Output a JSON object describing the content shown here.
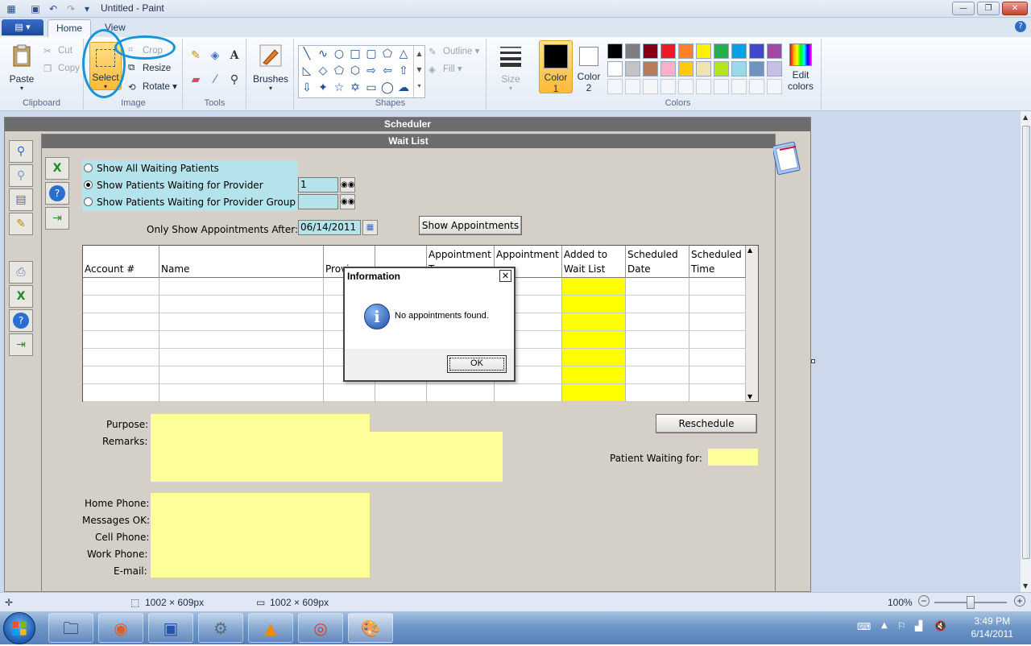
{
  "window": {
    "title": "Untitled - Paint"
  },
  "ribbon": {
    "file_tab": "▤ ▾",
    "tabs": [
      {
        "label": "Home",
        "active": true
      },
      {
        "label": "View",
        "active": false
      }
    ],
    "clipboard": {
      "paste": "Paste",
      "cut": "Cut",
      "copy": "Copy",
      "group": "Clipboard"
    },
    "image": {
      "select": "Select",
      "crop": "Crop",
      "resize": "Resize",
      "rotate": "Rotate",
      "group": "Image"
    },
    "tools": {
      "group": "Tools"
    },
    "brushes": "Brushes",
    "shapes": {
      "outline": "Outline",
      "fill": "Fill",
      "group": "Shapes"
    },
    "size": "Size",
    "colors": {
      "color1_label": "Color",
      "color1_num": "1",
      "color2_label": "Color",
      "color2_num": "2",
      "edit_label": "Edit",
      "edit_label2": "colors",
      "group": "Colors",
      "palette_row1": [
        "#000000",
        "#7f7f7f",
        "#880015",
        "#ed1c24",
        "#ff7f27",
        "#fff200",
        "#22b14c",
        "#00a2e8",
        "#3f48cc",
        "#a349a4"
      ],
      "palette_row2": [
        "#ffffff",
        "#c3c3c3",
        "#b97a57",
        "#ffaec9",
        "#ffc90e",
        "#efe4b0",
        "#b5e61d",
        "#99d9ea",
        "#7092be",
        "#c8bfe7"
      ],
      "accent": "#1a93d9"
    }
  },
  "scheduler": {
    "title": "Scheduler",
    "waitlist": {
      "title": "Wait List",
      "radios": [
        {
          "label": "Show All Waiting Patients",
          "selected": false
        },
        {
          "label": "Show Patients Waiting for Provider",
          "selected": true
        },
        {
          "label": "Show Patients Waiting for Provider Group",
          "selected": false
        }
      ],
      "provider_value": "1",
      "provider_group_value": "",
      "only_show_after_label": "Only Show Appointments After:",
      "date_value": "06/14/2011",
      "show_appointments_button": "Show Appointments",
      "columns": [
        {
          "l1": "",
          "l2": "Account #"
        },
        {
          "l1": "",
          "l2": "Name"
        },
        {
          "l1": "",
          "l2": "Provi"
        },
        {
          "l1": "",
          "l2": ""
        },
        {
          "l1": "Appointment",
          "l2": "T"
        },
        {
          "l1": "Appointment",
          "l2": ""
        },
        {
          "l1": "Added to",
          "l2": "Wait List"
        },
        {
          "l1": "Scheduled",
          "l2": "Date"
        },
        {
          "l1": "Scheduled",
          "l2": "Time"
        }
      ],
      "row_count": 7,
      "purpose_label": "Purpose:",
      "remarks_label": "Remarks:",
      "reschedule_button": "Reschedule",
      "patient_waiting_for_label": "Patient Waiting for:",
      "home_phone_label": "Home Phone:",
      "messages_ok_label": "Messages OK:",
      "cell_phone_label": "Cell Phone:",
      "work_phone_label": "Work Phone:",
      "email_label": "E-mail:"
    }
  },
  "dialog": {
    "title": "Information",
    "close": "✕",
    "icon": "i",
    "message": "No appointments found.",
    "ok": "OK"
  },
  "statusbar": {
    "selection_size": "1002 × 609px",
    "image_size": "1002 × 609px",
    "zoom": "100%"
  },
  "taskbar": {
    "time": "3:49 PM",
    "date": "6/14/2011"
  }
}
